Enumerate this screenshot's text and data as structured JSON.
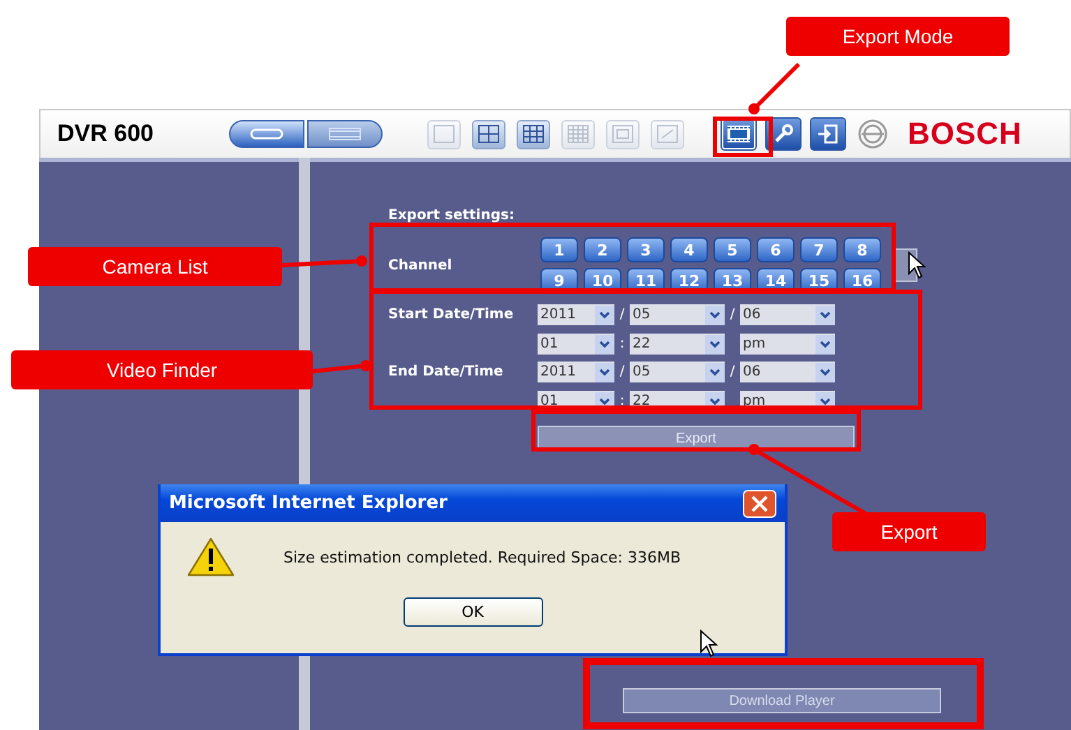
{
  "toolbar": {
    "title": "DVR 600",
    "mode_buttons": [
      {
        "kind": "live",
        "selected": true
      },
      {
        "kind": "playback",
        "selected": false
      }
    ],
    "layout_buttons": [
      {
        "kind": "single",
        "disabled": true
      },
      {
        "kind": "quad",
        "disabled": false
      },
      {
        "kind": "grid9",
        "disabled": false
      },
      {
        "kind": "grid16",
        "disabled": true
      },
      {
        "kind": "cascade",
        "disabled": true
      },
      {
        "kind": "fullscreen",
        "disabled": true
      }
    ],
    "tools": [
      {
        "kind": "export",
        "selected": true
      },
      {
        "kind": "settings",
        "selected": false
      },
      {
        "kind": "logout",
        "selected": false
      },
      {
        "kind": "logo",
        "selected": false
      }
    ],
    "brand": "BOSCH"
  },
  "export_settings": {
    "heading": "Export settings:",
    "channel_label": "Channel",
    "channels": [
      "1",
      "2",
      "3",
      "4",
      "5",
      "6",
      "7",
      "8",
      "9",
      "10",
      "11",
      "12",
      "13",
      "14",
      "15",
      "16"
    ],
    "rows": [
      {
        "label": "Start Date/Time",
        "date": [
          "2011",
          "05",
          "06"
        ],
        "date_seps": [
          "/",
          "/"
        ],
        "time": [
          "01",
          "22",
          "pm"
        ],
        "time_seps": [
          ":"
        ]
      },
      {
        "label": "End Date/Time",
        "date": [
          "2011",
          "05",
          "06"
        ],
        "date_seps": [
          "/",
          "/"
        ],
        "time": [
          "01",
          "22",
          "pm"
        ],
        "time_seps": [
          ":"
        ]
      }
    ],
    "export_button": "Export",
    "download_button": "Download Player"
  },
  "dialog": {
    "title": "Microsoft Internet Explorer",
    "message": "Size estimation completed. Required Space:  336MB",
    "ok": "OK"
  },
  "annotations": [
    {
      "label": "Export Mode"
    },
    {
      "label": "Camera List"
    },
    {
      "label": "Video Finder"
    },
    {
      "label": "Export"
    }
  ]
}
